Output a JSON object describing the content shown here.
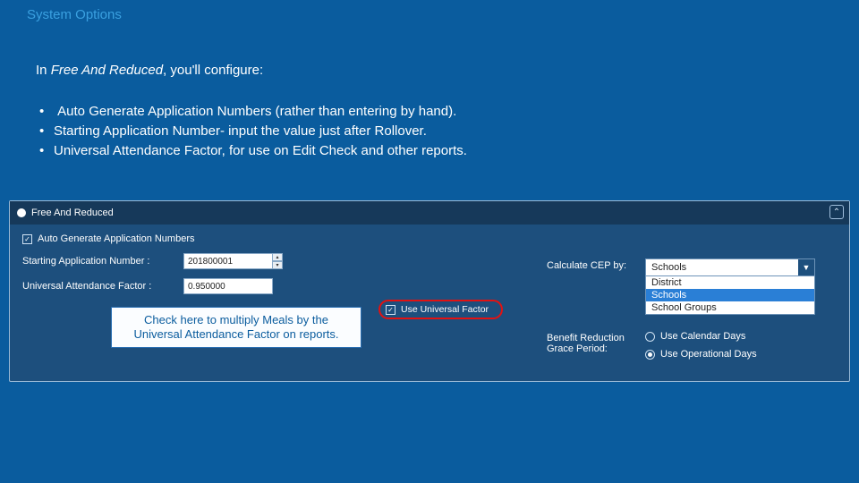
{
  "slide": {
    "title": "System Options",
    "intro_prefix": "In ",
    "intro_italic": "Free And Reduced",
    "intro_suffix": ", you'll configure:",
    "bullets": [
      {
        "italic": "Auto Generate Application Numbers",
        "rest": " (rather than entering by hand)."
      },
      {
        "italic": "Starting Application Number",
        "rest": "- input the value just after Rollover."
      },
      {
        "italic": "Universal Attendance Factor",
        "rest": ", for use on Edit Check and other reports."
      }
    ]
  },
  "panel": {
    "header": "Free And Reduced",
    "auto_generate_label": "Auto Generate Application Numbers",
    "starting_label": "Starting Application Number :",
    "starting_value": "201800001",
    "uaf_label": "Universal Attendance Factor :",
    "uaf_value": "0.950000",
    "use_universal_label": "Use Universal Factor",
    "calc_label": "Calculate CEP by:",
    "calc_selected": "Schools",
    "calc_options": [
      "District",
      "Schools",
      "School Groups"
    ],
    "grace_label": "Benefit Reduction Grace Period:",
    "grace_opt1": "Use Calendar Days",
    "grace_opt2": "Use Operational Days"
  },
  "callout": {
    "text": "Check here to multiply Meals by the Universal Attendance Factor on reports."
  }
}
